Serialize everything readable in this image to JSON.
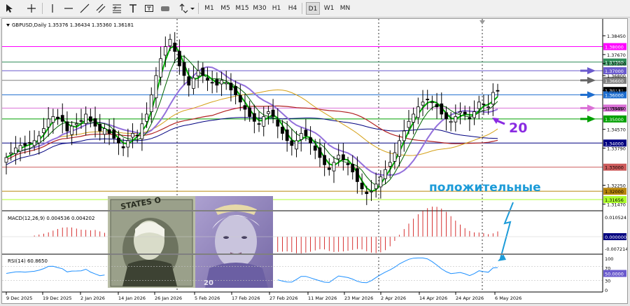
{
  "toolbar": {
    "timeframes": [
      "M1",
      "M5",
      "M15",
      "M30",
      "H1",
      "H4",
      "D1",
      "W1",
      "MN"
    ],
    "active_timeframe": "D1"
  },
  "chart": {
    "header": "GBPUSD,Daily  1.35376 1.36434 1.35360 1.36181",
    "annotation_number": "20",
    "annotation_word": "положительные",
    "colors": {
      "up_candle": "#ffffff",
      "down_candle": "#000000",
      "ema_fast": "#00b000",
      "ema_slow": "#006400",
      "ma_purple": "#9370db",
      "ma_orange": "#d4a017",
      "ma_red": "#b22222",
      "ma_navy": "#000080",
      "annotation": "#1c9bd8",
      "number": "#8a2be2"
    },
    "icons": [
      "cursor-icon",
      "crosshair-icon",
      "vertical-line-icon",
      "horizontal-line-icon",
      "trendline-icon",
      "channel-icon",
      "fibonacci-icon",
      "text-icon",
      "label-icon",
      "shapes-icon",
      "arrow-icon"
    ]
  },
  "chart_data": {
    "type": "candlestick",
    "symbol": "GBPUSD",
    "timeframe": "Daily",
    "ohlc_last": {
      "open": 1.35376,
      "high": 1.36434,
      "low": 1.3536,
      "close": 1.36181
    },
    "price_axis": [
      "1.38450",
      "1.37670",
      "1.37300",
      "1.36800",
      "1.36180",
      "1.35450",
      "1.34570",
      "1.33790",
      "1.32250",
      "1.31470"
    ],
    "levels": [
      {
        "label": "1.38000",
        "price": 1.38,
        "color": "#ff00ff"
      },
      {
        "label": "1.37360",
        "price": 1.3736,
        "color": "#2e8b57"
      },
      {
        "label": "1.37000",
        "price": 1.37,
        "color": "#6a5acd"
      },
      {
        "label": "1.36600",
        "price": 1.366,
        "color": "#808080"
      },
      {
        "label": "1.36181",
        "price": 1.36181,
        "color": "#000000"
      },
      {
        "label": "1.36000",
        "price": 1.36,
        "color": "#1e6ecf"
      },
      {
        "label": "1.35450",
        "price": 1.3545,
        "color": "#da70d6"
      },
      {
        "label": "1.35000",
        "price": 1.35,
        "color": "#00a000"
      },
      {
        "label": "1.34000",
        "price": 1.34,
        "color": "#000080"
      },
      {
        "label": "1.33000",
        "price": 1.33,
        "color": "#cd5c5c"
      },
      {
        "label": "1.32000",
        "price": 1.32,
        "color": "#b8860b"
      },
      {
        "label": "1.31656",
        "price": 1.31656,
        "color": "#adff2f"
      }
    ],
    "ylim": [
      1.3125,
      1.388
    ],
    "x_labels": [
      "9 Dec 2025",
      "19 Dec 2025",
      "2 Jan 2026",
      "14 Jan 2026",
      "26 Jan 2026",
      "5 Feb 2026",
      "17 Feb 2026",
      "27 Feb 2026",
      "11 Mar 2026",
      "23 Mar 2026",
      "2 Apr 2026",
      "14 Apr 2026",
      "24 Apr 2026",
      "6 May 2026"
    ],
    "closes": [
      1.334,
      1.336,
      1.338,
      1.339,
      1.339,
      1.34,
      1.341,
      1.343,
      1.346,
      1.35,
      1.351,
      1.35,
      1.349,
      1.345,
      1.347,
      1.348,
      1.349,
      1.352,
      1.349,
      1.347,
      1.345,
      1.346,
      1.344,
      1.342,
      1.34,
      1.338,
      1.341,
      1.344,
      1.343,
      1.348,
      1.352,
      1.36,
      1.368,
      1.375,
      1.38,
      1.383,
      1.378,
      1.372,
      1.368,
      1.364,
      1.367,
      1.37,
      1.368,
      1.366,
      1.365,
      1.364,
      1.366,
      1.365,
      1.362,
      1.36,
      1.357,
      1.354,
      1.351,
      1.349,
      1.348,
      1.351,
      1.353,
      1.351,
      1.347,
      1.344,
      1.341,
      1.339,
      1.341,
      1.344,
      1.343,
      1.34,
      1.337,
      1.334,
      1.331,
      1.329,
      1.332,
      1.335,
      1.333,
      1.331,
      1.328,
      1.324,
      1.321,
      1.319,
      1.32,
      1.323,
      1.326,
      1.329,
      1.332,
      1.336,
      1.341,
      1.345,
      1.349,
      1.352,
      1.355,
      1.357,
      1.358,
      1.357,
      1.355,
      1.352,
      1.35,
      1.349,
      1.351,
      1.353,
      1.352,
      1.35,
      1.353,
      1.357,
      1.356,
      1.355,
      1.361,
      1.3618
    ],
    "macd": {
      "label": "MACD(12,26,9) 0.004536 0.004202",
      "axis": [
        "0.010524",
        "0.000000",
        "-0.007214"
      ]
    },
    "rsi": {
      "label": "RSI(14) 60.8650",
      "axis": [
        "100",
        "70",
        "50.0000",
        "30",
        "0"
      ]
    }
  }
}
